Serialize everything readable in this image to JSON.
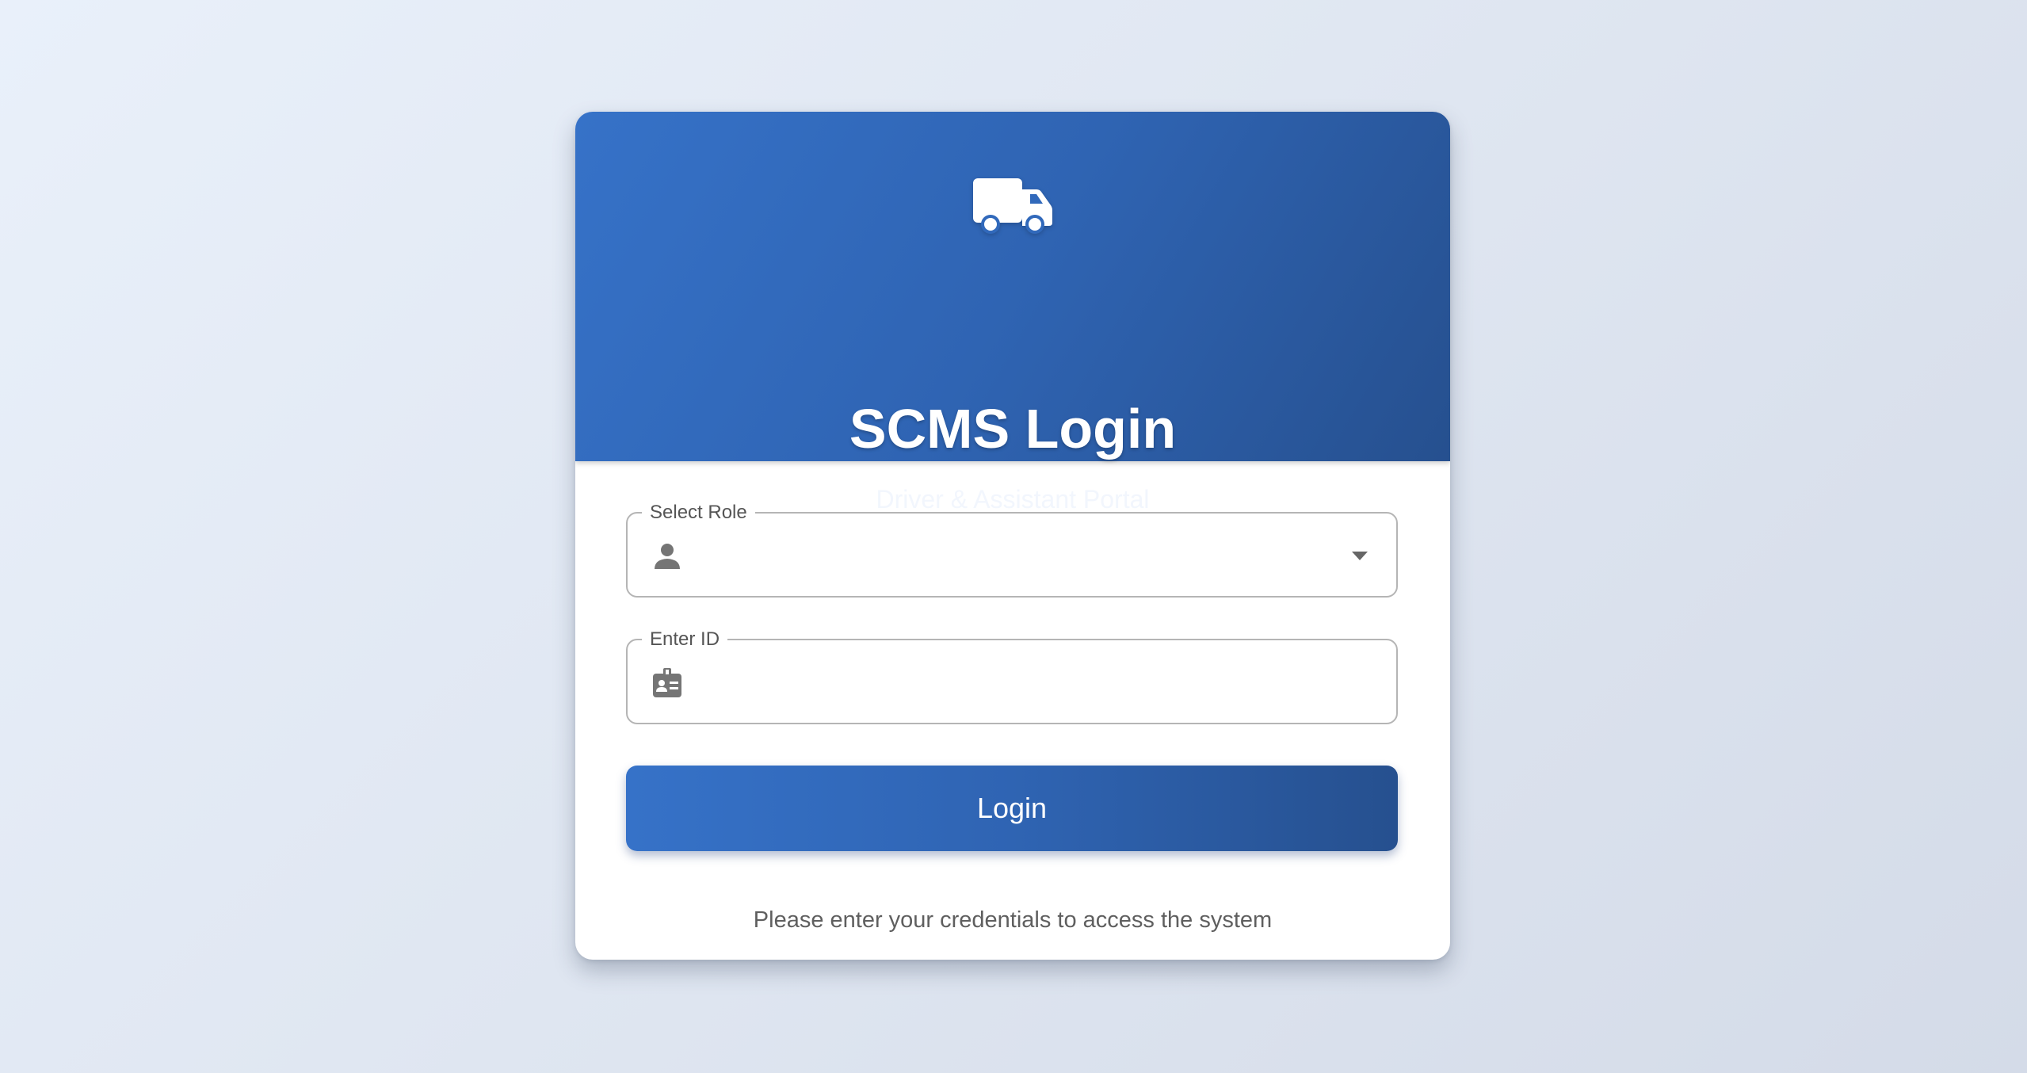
{
  "header": {
    "icon": "truck-icon",
    "title": "SCMS Login",
    "subtitle": "Driver & Assistant Portal"
  },
  "form": {
    "role_field": {
      "label": "Select Role",
      "icon": "person-icon",
      "value": ""
    },
    "id_field": {
      "label": "Enter ID",
      "icon": "id-badge-icon",
      "value": ""
    },
    "login_label": "Login"
  },
  "footer": {
    "helper_text": "Please enter your credentials to access the system"
  },
  "colors": {
    "primary": "#3672c8",
    "primary_dark": "#26508f",
    "background": "#e3e9f3"
  }
}
